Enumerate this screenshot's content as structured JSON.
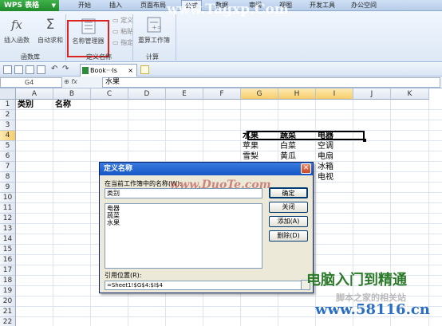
{
  "menubar": {
    "app_button": "WPS 表格",
    "tabs": [
      "开始",
      "插入",
      "页面布局",
      "公式",
      "数据",
      "审阅",
      "视图",
      "开发工具",
      "办公空间"
    ],
    "active_tab": "公式"
  },
  "ribbon": {
    "insert_function": "插入函数",
    "autosum": "自动求和",
    "name_manager": "名称管理器",
    "define": "定义",
    "paste": "粘贴",
    "specify": "指定",
    "recalc": "重算工作簿",
    "groups": {
      "function_library": "函数库",
      "defined_names": "定义名称",
      "calculation": "计算"
    }
  },
  "doc": {
    "tab_label": "Book···ls",
    "close": "×"
  },
  "formula_bar": {
    "name_box": "G4",
    "value": "水果"
  },
  "grid": {
    "columns": [
      "A",
      "B",
      "C",
      "D",
      "E",
      "F",
      "G",
      "H",
      "I",
      "J",
      "K"
    ],
    "rows": [
      "1",
      "2",
      "3",
      "4",
      "5",
      "6",
      "7",
      "8",
      "9",
      "10",
      "11",
      "12",
      "13",
      "14",
      "15",
      "16",
      "17",
      "18",
      "19",
      "20",
      "21",
      "22"
    ],
    "a1": "类别",
    "b1": "名称",
    "g4": "水果",
    "h4": "蔬菜",
    "i4": "电器",
    "g5": "苹果",
    "h5": "白菜",
    "i5": "空调",
    "g6": "雪梨",
    "h6": "黄瓜",
    "i6": "电扇",
    "i7": "冰箱",
    "i8": "电视"
  },
  "dialog": {
    "title": "定义名称",
    "name_label": "在当前工作簿中的名称(W):",
    "name_value": "类别",
    "list_items": [
      "电器",
      "蔬菜",
      "水果"
    ],
    "ok": "确定",
    "close": "关闭",
    "add": "添加(A)",
    "delete": "删除(D)",
    "ref_label": "引用位置(R):",
    "ref_value": "=Sheet1!$G$4:$I$4"
  },
  "watermarks": {
    "tagxp": "www.Tagxp.Com",
    "duote": "www.DuoTe.com",
    "site_cn": "电脑入门到精通",
    "url": "www.58116.cn",
    "shadow": "脚本之家的相关站"
  },
  "colors": {
    "accent": "#1556c6",
    "highlight": "#d22222",
    "selection": "#f7cd6b"
  }
}
